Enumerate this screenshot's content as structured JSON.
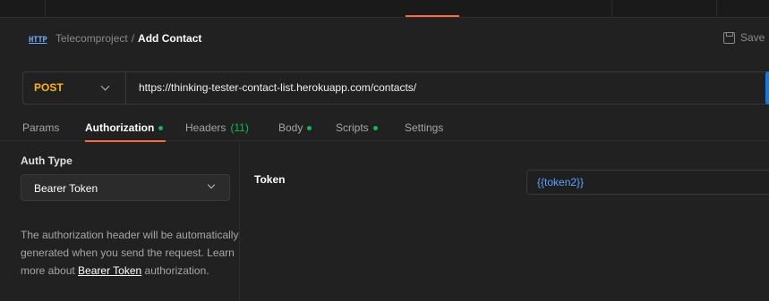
{
  "breadcrumb": {
    "icon": "HTTP",
    "parent": "Telecomproject",
    "separator": "/",
    "current": "Add Contact"
  },
  "toolbar": {
    "save_label": "Save"
  },
  "request": {
    "method": "POST",
    "url": "https://thinking-tester-contact-list.herokuapp.com/contacts/"
  },
  "tabs": [
    {
      "label": "Params"
    },
    {
      "label": "Authorization"
    },
    {
      "label": "Headers",
      "count": "(11)"
    },
    {
      "label": "Body"
    },
    {
      "label": "Scripts"
    },
    {
      "label": "Settings"
    }
  ],
  "auth": {
    "type_label": "Auth Type",
    "type_value": "Bearer Token",
    "help_text": "The authorization header will be automatically generated when you send the request. Learn more about",
    "help_link": "Bearer Token",
    "help_suffix": "authorization.",
    "token_label": "Token",
    "token_value": "{{token2}}"
  },
  "colors": {
    "accent": "#ff6c37",
    "method": "#ffb400",
    "status_dot": "#0cbb52",
    "variable": "#5aa3ff",
    "primary": "#097bed"
  }
}
